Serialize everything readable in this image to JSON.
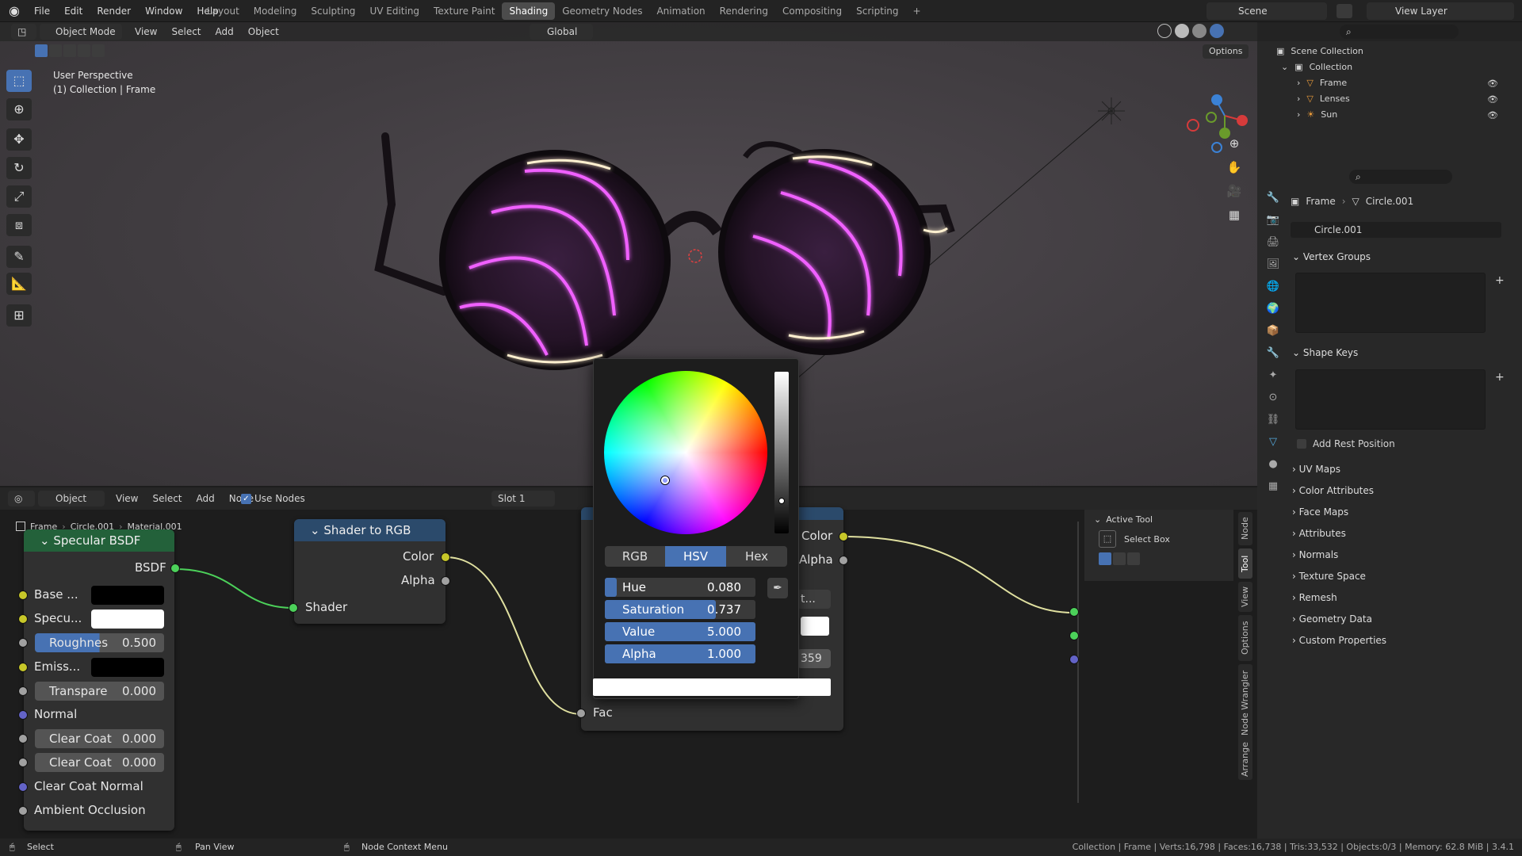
{
  "topbar": {
    "menus": [
      "File",
      "Edit",
      "Render",
      "Window",
      "Help"
    ],
    "workspaces": [
      "Layout",
      "Modeling",
      "Sculpting",
      "UV Editing",
      "Texture Paint",
      "Shading",
      "Geometry Nodes",
      "Animation",
      "Rendering",
      "Compositing",
      "Scripting"
    ],
    "active_workspace": "Shading",
    "add_tab": "+",
    "scene": "Scene",
    "view_layer": "View Layer"
  },
  "viewport": {
    "mode": "Object Mode",
    "menus": [
      "View",
      "Select",
      "Add",
      "Object"
    ],
    "orientation": "Global",
    "options": "Options",
    "perspective": "User Perspective",
    "collection_info": "(1) Collection | Frame"
  },
  "node_editor": {
    "type": "Object",
    "menus": [
      "View",
      "Select",
      "Add",
      "Node"
    ],
    "use_nodes_label": "Use Nodes",
    "slot": "Slot 1",
    "breadcrumb": [
      "Frame",
      "Circle.001",
      "Material.001"
    ]
  },
  "specular_node": {
    "title": "Specular BSDF",
    "output": "BSDF",
    "inputs": [
      {
        "label": "Base ...",
        "type": "color",
        "color": "#000000"
      },
      {
        "label": "Specu...",
        "type": "color",
        "color": "#ffffff"
      },
      {
        "label": "Roughnes",
        "value": "0.500",
        "type": "slider"
      },
      {
        "label": "Emiss...",
        "type": "color",
        "color": "#000000"
      },
      {
        "label": "Transpare",
        "value": "0.000",
        "type": "slider"
      },
      {
        "label": "Normal",
        "type": "plain"
      },
      {
        "label": "Clear Coat",
        "value": "0.000",
        "type": "slider"
      },
      {
        "label": "Clear Coat",
        "value": "0.000",
        "type": "slider"
      },
      {
        "label": "Clear Coat Normal",
        "type": "plain"
      },
      {
        "label": "Ambient Occlusion",
        "type": "plain"
      }
    ]
  },
  "shader_rgb_node": {
    "title": "Shader to RGB",
    "out_color": "Color",
    "out_alpha": "Alpha",
    "in_shader": "Shader"
  },
  "mix_node": {
    "out_color": "Color",
    "out_alpha": "Alpha",
    "in_fac": "Fac",
    "partial_dropdown": "t...",
    "partial_value": "359"
  },
  "color_picker": {
    "tabs": [
      "RGB",
      "HSV",
      "Hex"
    ],
    "active_tab": "HSV",
    "fields": [
      {
        "label": "Hue",
        "value": "0.080",
        "fill": 0.08
      },
      {
        "label": "Saturation",
        "value": "0.737",
        "fill": 0.737
      },
      {
        "label": "Value",
        "value": "5.000",
        "fill": 1.0
      },
      {
        "label": "Alpha",
        "value": "1.000",
        "fill": 1.0
      }
    ],
    "swatch_color": "#ffffff"
  },
  "active_tool": {
    "title": "Active Tool",
    "tool": "Select Box"
  },
  "side_tabs": [
    "Node",
    "Tool",
    "View",
    "Options",
    "Node Wrangler",
    "Arrange"
  ],
  "outliner": {
    "root": "Scene Collection",
    "collection": "Collection",
    "items": [
      "Frame",
      "Lenses",
      "Sun"
    ]
  },
  "properties": {
    "breadcrumb_object": "Frame",
    "breadcrumb_mesh": "Circle.001",
    "mesh_name": "Circle.001",
    "vertex_groups": "Vertex Groups",
    "shape_keys": "Shape Keys",
    "add_rest_position": "Add Rest Position",
    "sections": [
      "UV Maps",
      "Color Attributes",
      "Face Maps",
      "Attributes",
      "Normals",
      "Texture Space",
      "Remesh",
      "Geometry Data",
      "Custom Properties"
    ]
  },
  "statusbar": {
    "select": "Select",
    "pan": "Pan View",
    "context": "Node Context Menu",
    "stats": "Collection | Frame | Verts:16,798 | Faces:16,738 | Tris:33,532 | Objects:0/3 | Memory: 62.8 MiB | 3.4.1"
  },
  "colors": {
    "accent": "#4772b3",
    "neon": "#e040ff",
    "node_header": "#1f5e57"
  }
}
